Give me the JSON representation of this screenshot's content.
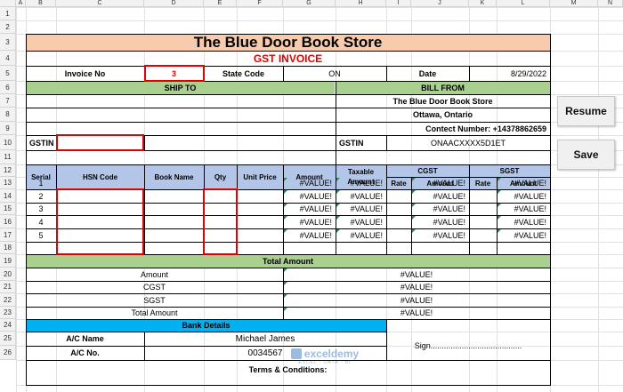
{
  "columns": [
    "A",
    "B",
    "C",
    "D",
    "E",
    "F",
    "G",
    "H",
    "I",
    "J",
    "K",
    "L",
    "M",
    "N"
  ],
  "rows": [
    "1",
    "2",
    "3",
    "4",
    "5",
    "6",
    "7",
    "8",
    "9",
    "10",
    "11",
    "12",
    "13",
    "14",
    "15",
    "16",
    "17",
    "18",
    "19",
    "20",
    "21",
    "22",
    "23",
    "24",
    "25",
    "26"
  ],
  "invoice": {
    "store_name": "The Blue Door Book Store",
    "doc_title": "GST INVOICE",
    "invoice_no_label": "Invoice No",
    "invoice_no": "3",
    "state_code_label": "State Code",
    "state_code": "ON",
    "date_label": "Date",
    "date": "8/29/2022",
    "ship_to": "SHIP TO",
    "bill_from": "BILL FROM",
    "bill_store": "The Blue Door Book Store",
    "bill_city": "Ottawa, Ontario",
    "bill_contact": "Contect Number: +14378862659",
    "gstin_label": "GSTIN",
    "gstin_bill_label": "GSTIN",
    "gstin_bill": "ONAACXXXX5D1ET"
  },
  "table": {
    "headers": {
      "serial": "Serial",
      "hsn": "HSN Code",
      "book": "Book Name",
      "qty": "Qty",
      "unit_price": "Unit Price",
      "amount": "Amount",
      "taxable_amount": "Taxable Amount",
      "cgst": "CGST",
      "sgst": "SGST",
      "rate": "Rate",
      "sub_amount": "Amount"
    },
    "serials": [
      "1",
      "2",
      "3",
      "4",
      "5"
    ],
    "error_value": "#VALUE!"
  },
  "totals": {
    "title": "Total Amount",
    "labels": [
      "Amount",
      "CGST",
      "SGST",
      "Total Amount"
    ],
    "values": [
      "#VALUE!",
      "#VALUE!",
      "#VALUE!",
      "#VALUE!"
    ]
  },
  "bank": {
    "title": "Bank Details",
    "ac_name_label": "A/C Name",
    "ac_name": "Michael James",
    "ac_no_label": "A/C No.",
    "ac_no": "0034567",
    "sign": "Sign.........................................",
    "terms": "Terms & Conditions:"
  },
  "buttons": {
    "resume": "Resume",
    "save": "Save"
  },
  "watermark": "exceldemy",
  "watermark_sub": "EXCEL · DATA · BI",
  "colors": {
    "peach": "#f8cbad",
    "green": "#a9d08e",
    "blue": "#b4c6e7",
    "cyan": "#00b0f0",
    "red": "#e00000"
  }
}
